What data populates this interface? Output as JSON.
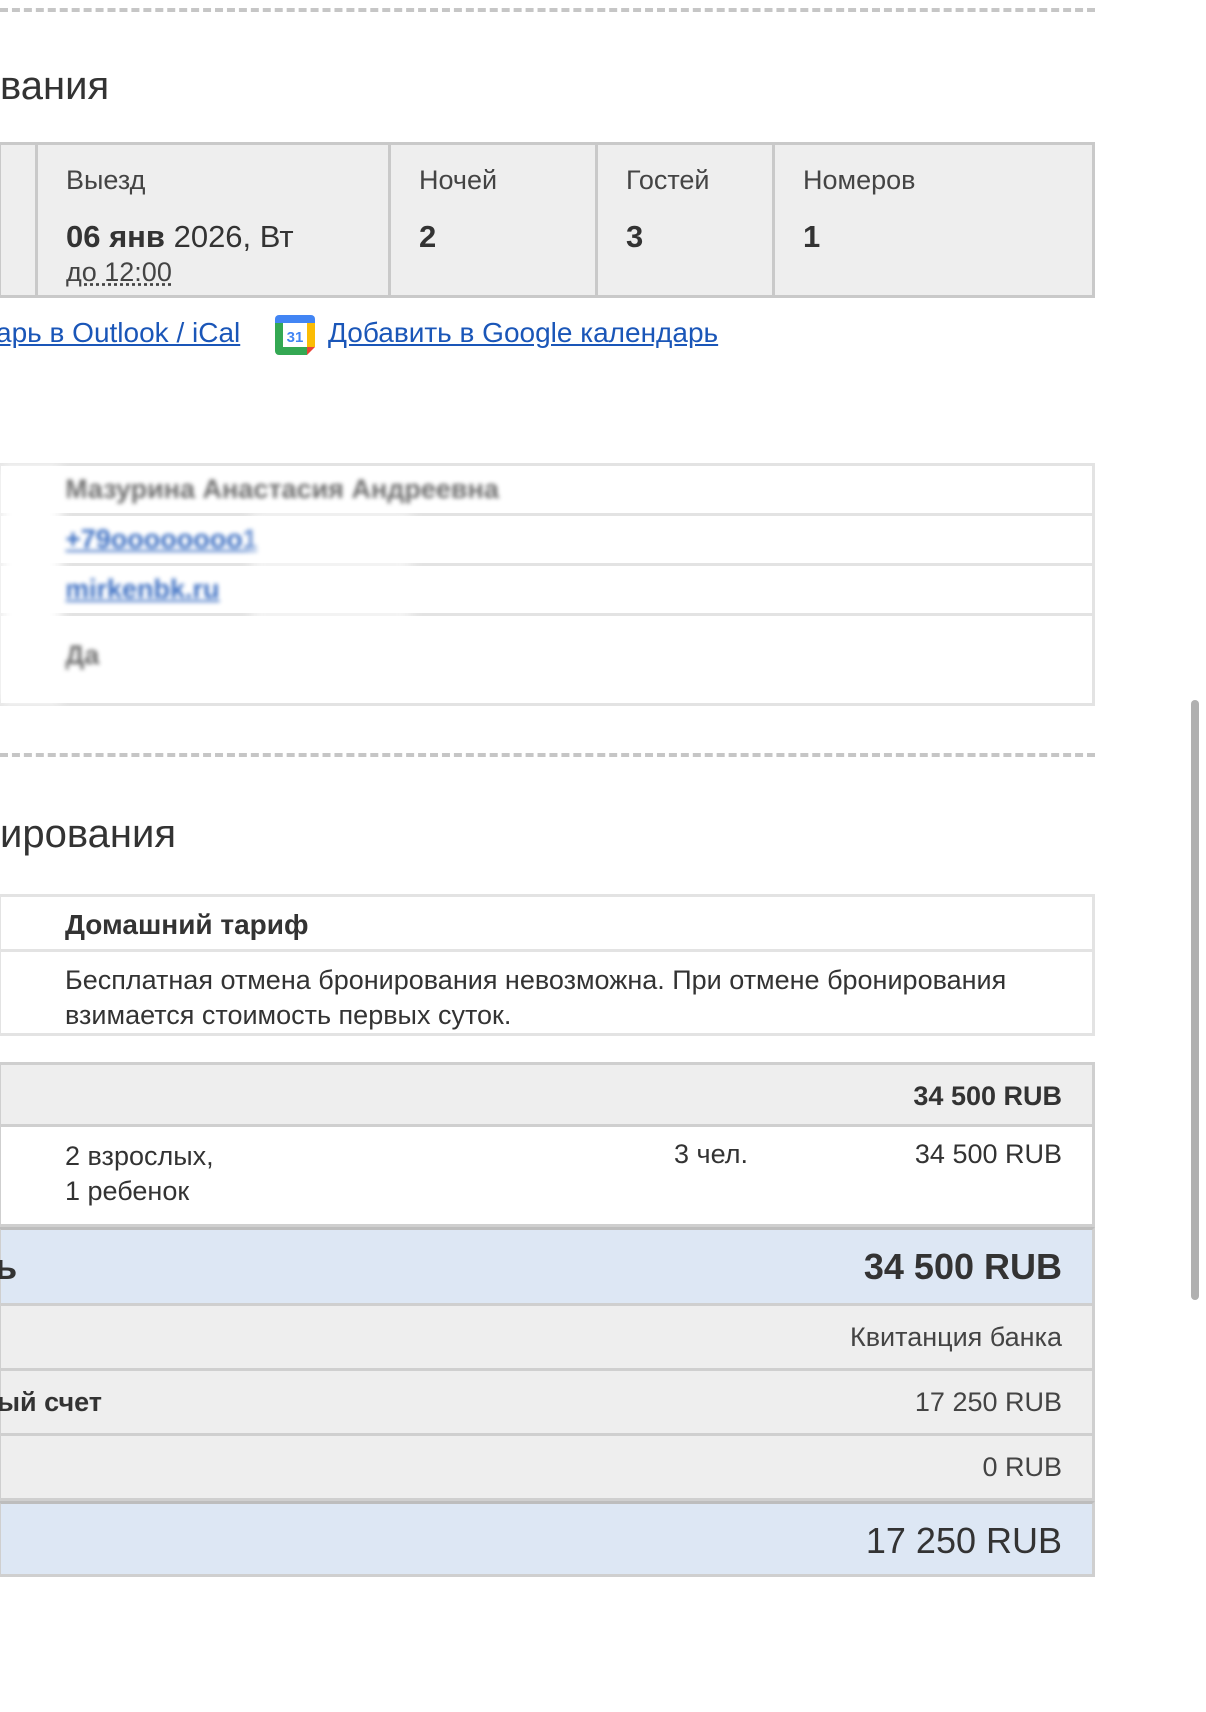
{
  "sections": {
    "stay_title": "вания",
    "booking_title": "ирования"
  },
  "stay": {
    "checkout_label": "Выезд",
    "checkout_day": "06 янв",
    "checkout_rest": " 2026, Вт",
    "checkout_time": "до 12:00",
    "nights_label": "Ночей",
    "nights": "2",
    "guests_label": "Гостей",
    "guests": "3",
    "rooms_label": "Номеров",
    "rooms": "1"
  },
  "calendar": {
    "outlook_link": "арь в Outlook / iCal",
    "google_icon_day": "31",
    "google_link": "Добавить в Google календарь"
  },
  "guest": {
    "name": "Мазурина Анастасия Андреевна",
    "phone": "+79оооооооо1",
    "email": "mirkenbk.ru",
    "comment": "Да"
  },
  "rate": {
    "name": "Домашний тариф",
    "description": "Бесплатная отмена бронирования невозможна. При отмене бронирования взимается стоимость первых суток."
  },
  "prices": {
    "room_total": "34 500 RUB",
    "guests_desc": "2 взрослых,\n1 ребенок",
    "guests_count": "3 чел.",
    "guests_price": "34 500 RUB",
    "total_label": "ь",
    "total": "34 500 RUB",
    "payment_method": "Квитанция банка",
    "deposit_label": "ый счет",
    "deposit": "17 250 RUB",
    "paid_label": "ı",
    "paid": "0 RUB",
    "due": "17 250 RUB"
  },
  "colors": {
    "link": "#1a56b8",
    "highlight_row": "#dde7f4",
    "header_row": "#eeeeee"
  }
}
